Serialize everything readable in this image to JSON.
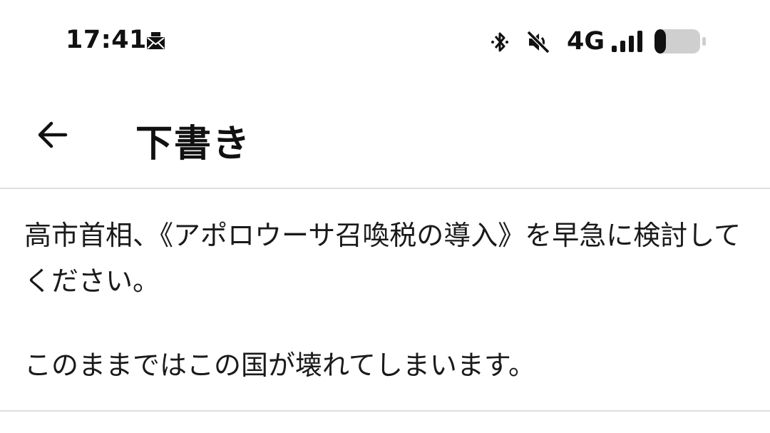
{
  "status_bar": {
    "time": "17:41",
    "network": "4G",
    "battery_level": 0.15
  },
  "app_bar": {
    "title": "下書き"
  },
  "draft": {
    "paragraphs": [
      "高市首相、《アポロウーサ召喚税の導入》を早急に検討してください。",
      "このままではこの国が壊れてしまいます。"
    ]
  },
  "icons": {
    "notification": "mail-icon",
    "bluetooth": "bluetooth-icon",
    "sound": "mute-icon",
    "signal": "signal-bars-icon",
    "battery": "battery-icon",
    "back": "arrow-left-icon"
  }
}
